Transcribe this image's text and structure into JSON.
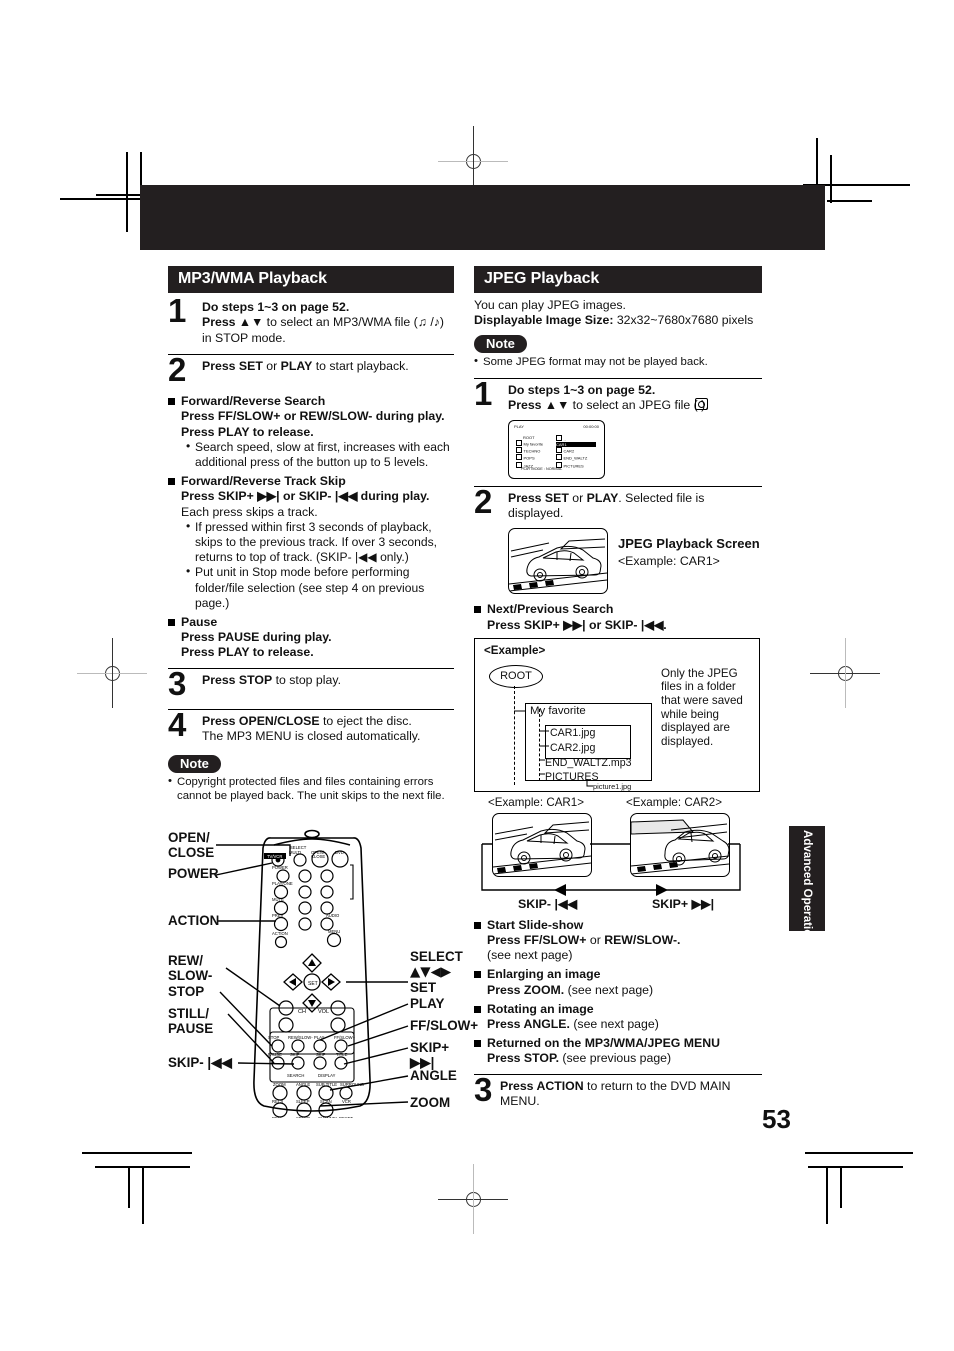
{
  "page": {
    "number": "53",
    "side_tab": "Advanced Operation"
  },
  "left": {
    "heading": "MP3/WMA Playback",
    "steps": [
      {
        "num": "1",
        "l1_b": "Do steps 1~3 on page 52.",
        "l2_b": "Press ▲▼",
        "l2_r": " to select an MP3/WMA file (♫ /♪) in STOP mode."
      },
      {
        "num": "2",
        "l1_b": "Press SET",
        "l1_r": " or ",
        "l1_b2": "PLAY",
        "l1_r2": " to start playback."
      },
      {
        "num": "3",
        "l1_b": "Press STOP",
        "l1_r": " to stop play."
      },
      {
        "num": "4",
        "l1_b": "Press OPEN/CLOSE",
        "l1_r": " to eject the disc.",
        "l2": "The MP3 MENU is closed automatically."
      }
    ],
    "sections": [
      {
        "title": "Forward/Reverse Search",
        "lines": [
          "Press FF/SLOW+ or REW/SLOW- during play.",
          "Press PLAY to release."
        ],
        "bullets": [
          "Search speed, slow at first, increases with each additional press of the button up to 5 levels."
        ]
      },
      {
        "title": "Forward/Reverse Track Skip",
        "lines": [
          "Press SKIP+ ▶▶| or SKIP- |◀◀ during play.",
          "Each press skips a track."
        ],
        "bullets": [
          "If pressed within first 3 seconds of playback, skips to the previous track. If over 3 seconds, returns to top of track. (SKIP- |◀◀ only.)",
          "Put unit in Stop mode before performing folder/file selection (see step 4 on previous page.)"
        ]
      },
      {
        "title": "Pause",
        "lines": [
          "Press PAUSE during play.",
          "Press PLAY to release."
        ],
        "bullets": []
      }
    ],
    "note_label": "Note",
    "note_text": "Copyright protected files and files containing errors cannot be played back. The unit skips to the next file."
  },
  "remote": {
    "labels_left": [
      "OPEN/",
      "CLOSE",
      "POWER",
      "ACTION",
      "REW/",
      "SLOW-",
      "STOP",
      "STILL/",
      "PAUSE",
      "SKIP- |◀◀"
    ],
    "left_items": [
      {
        "l1": "OPEN/",
        "l2": "CLOSE"
      },
      {
        "l1": "POWER",
        "l2": ""
      },
      {
        "l1": "ACTION",
        "l2": ""
      },
      {
        "l1": "REW/",
        "l2": "SLOW-"
      },
      {
        "l1": "STOP",
        "l2": ""
      },
      {
        "l1": "STILL/",
        "l2": "PAUSE"
      },
      {
        "l1": "SKIP- |◀◀",
        "l2": ""
      }
    ],
    "right_items": [
      {
        "l1": "SELECT",
        "l2": "▲▼◀▶",
        "l3": "SET"
      },
      {
        "l1": "PLAY",
        "l2": "",
        "l3": ""
      },
      {
        "l1": "FF/SLOW+",
        "l2": "",
        "l3": ""
      },
      {
        "l1": "SKIP+ ▶▶|",
        "l2": "",
        "l3": ""
      },
      {
        "l1": "ANGLE",
        "l2": "",
        "l3": ""
      },
      {
        "l1": "ZOOM",
        "l2": "",
        "l3": ""
      }
    ]
  },
  "right": {
    "heading": "JPEG Playback",
    "intro1": "You can play JPEG images.",
    "intro2_b": "Displayable Image Size:",
    "intro2_r": " 32x32~7680x7680 pixels",
    "note_label": "Note",
    "note_text": "Some JPEG format may not be played back.",
    "steps": [
      {
        "num": "1",
        "l1_b": "Do steps 1~3 on page 52.",
        "l2_b": "Press ▲▼",
        "l2_r": " to select an JPEG file (  )."
      },
      {
        "num": "2",
        "l1_b": "Press SET",
        "l1_r": " or ",
        "l1_b2": "PLAY",
        "l1_r2": ". Selected file is displayed."
      },
      {
        "num": "3",
        "l1_b": "Press ACTION",
        "l1_r": " to return to the DVD MAIN MENU."
      }
    ],
    "osd": {
      "title": "PLAY",
      "time": "00:00:00",
      "left_items": [
        "ROOT",
        "My favorite",
        "TECHNO",
        "POPS",
        "JAZZ"
      ],
      "right_items": [
        "..",
        "CAR1",
        "CAR2",
        "END_WALTZ",
        "PICTURES"
      ],
      "highlight": "CAR1",
      "footer": "PLAY MODE : NORMAL"
    },
    "playback_screen_title": "JPEG Playback Screen",
    "playback_screen_example": "<Example: CAR1>",
    "search_section": {
      "title": "Next/Previous Search",
      "line": "Press SKIP+ ▶▶| or SKIP- |◀◀."
    },
    "example_box": {
      "title": "<Example>",
      "root": "ROOT",
      "folder": "My favorite",
      "files": [
        "CAR1.jpg",
        "CAR2.jpg",
        "END_WALTZ.mp3",
        "PICTURES"
      ],
      "subfile": "picture1.jpg",
      "note": "Only the JPEG files in a folder that were saved while being displayed are displayed."
    },
    "skip_diagram": {
      "left_caption": "<Example: CAR1>",
      "right_caption": "<Example: CAR2>",
      "left_label": "SKIP- |◀◀",
      "right_label": "SKIP+ ▶▶|"
    },
    "sections": [
      {
        "title": "Start Slide-show",
        "line_b": "Press FF/SLOW+",
        "line_r": " or ",
        "line_b2": "REW/SLOW-.",
        "line_r2": "",
        "extra": "(see next page)"
      },
      {
        "title": "Enlarging an image",
        "line_b": "Press ZOOM.",
        "line_r": " (see next page)",
        "line_b2": "",
        "line_r2": "",
        "extra": ""
      },
      {
        "title": "Rotating an image",
        "line_b": "Press ANGLE.",
        "line_r": " (see next page)",
        "line_b2": "",
        "line_r2": "",
        "extra": ""
      },
      {
        "title": "Returned on the MP3/WMA/JPEG MENU",
        "line_b": "Press STOP.",
        "line_r": " (see previous page)",
        "line_b2": "",
        "line_r2": "",
        "extra": ""
      }
    ]
  }
}
